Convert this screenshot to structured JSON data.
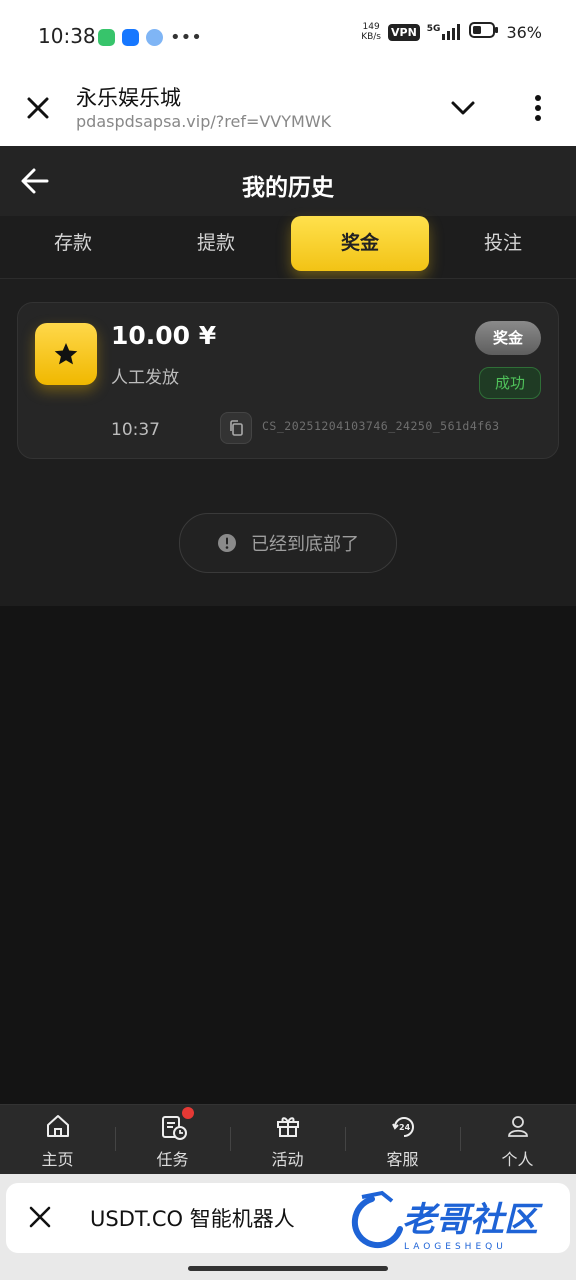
{
  "status_bar": {
    "time": "10:38",
    "net_speed_value": "149",
    "net_speed_unit": "KB/s",
    "vpn": "VPN",
    "signal": "5G",
    "battery": "36%"
  },
  "browser": {
    "title": "永乐娱乐城",
    "url": "pdaspdsapsa.vip/?ref=VVYMWK"
  },
  "header": {
    "title": "我的历史"
  },
  "tabs": [
    {
      "label": "存款",
      "active": false
    },
    {
      "label": "提款",
      "active": false
    },
    {
      "label": "奖金",
      "active": true
    },
    {
      "label": "投注",
      "active": false
    }
  ],
  "record": {
    "amount": "10.00 ¥",
    "source": "人工发放",
    "type": "奖金",
    "status": "成功",
    "time": "10:37",
    "order_id": "CS_20251204103746_24250_561d4f63"
  },
  "end_message": "已经到底部了",
  "bottom_nav": [
    {
      "label": "主页",
      "icon": "home-icon"
    },
    {
      "label": "任务",
      "icon": "task-icon"
    },
    {
      "label": "活动",
      "icon": "gift-icon"
    },
    {
      "label": "客服",
      "icon": "support-24h-icon"
    },
    {
      "label": "个人",
      "icon": "user-icon"
    }
  ],
  "banner": {
    "text": "USDT.CO 智能机器人",
    "watermark_text": "老哥社区",
    "watermark_sub": "LAOGESHEQU"
  },
  "colors": {
    "accent": "#f2c315",
    "success": "#4fc15a",
    "background": "#151515"
  }
}
